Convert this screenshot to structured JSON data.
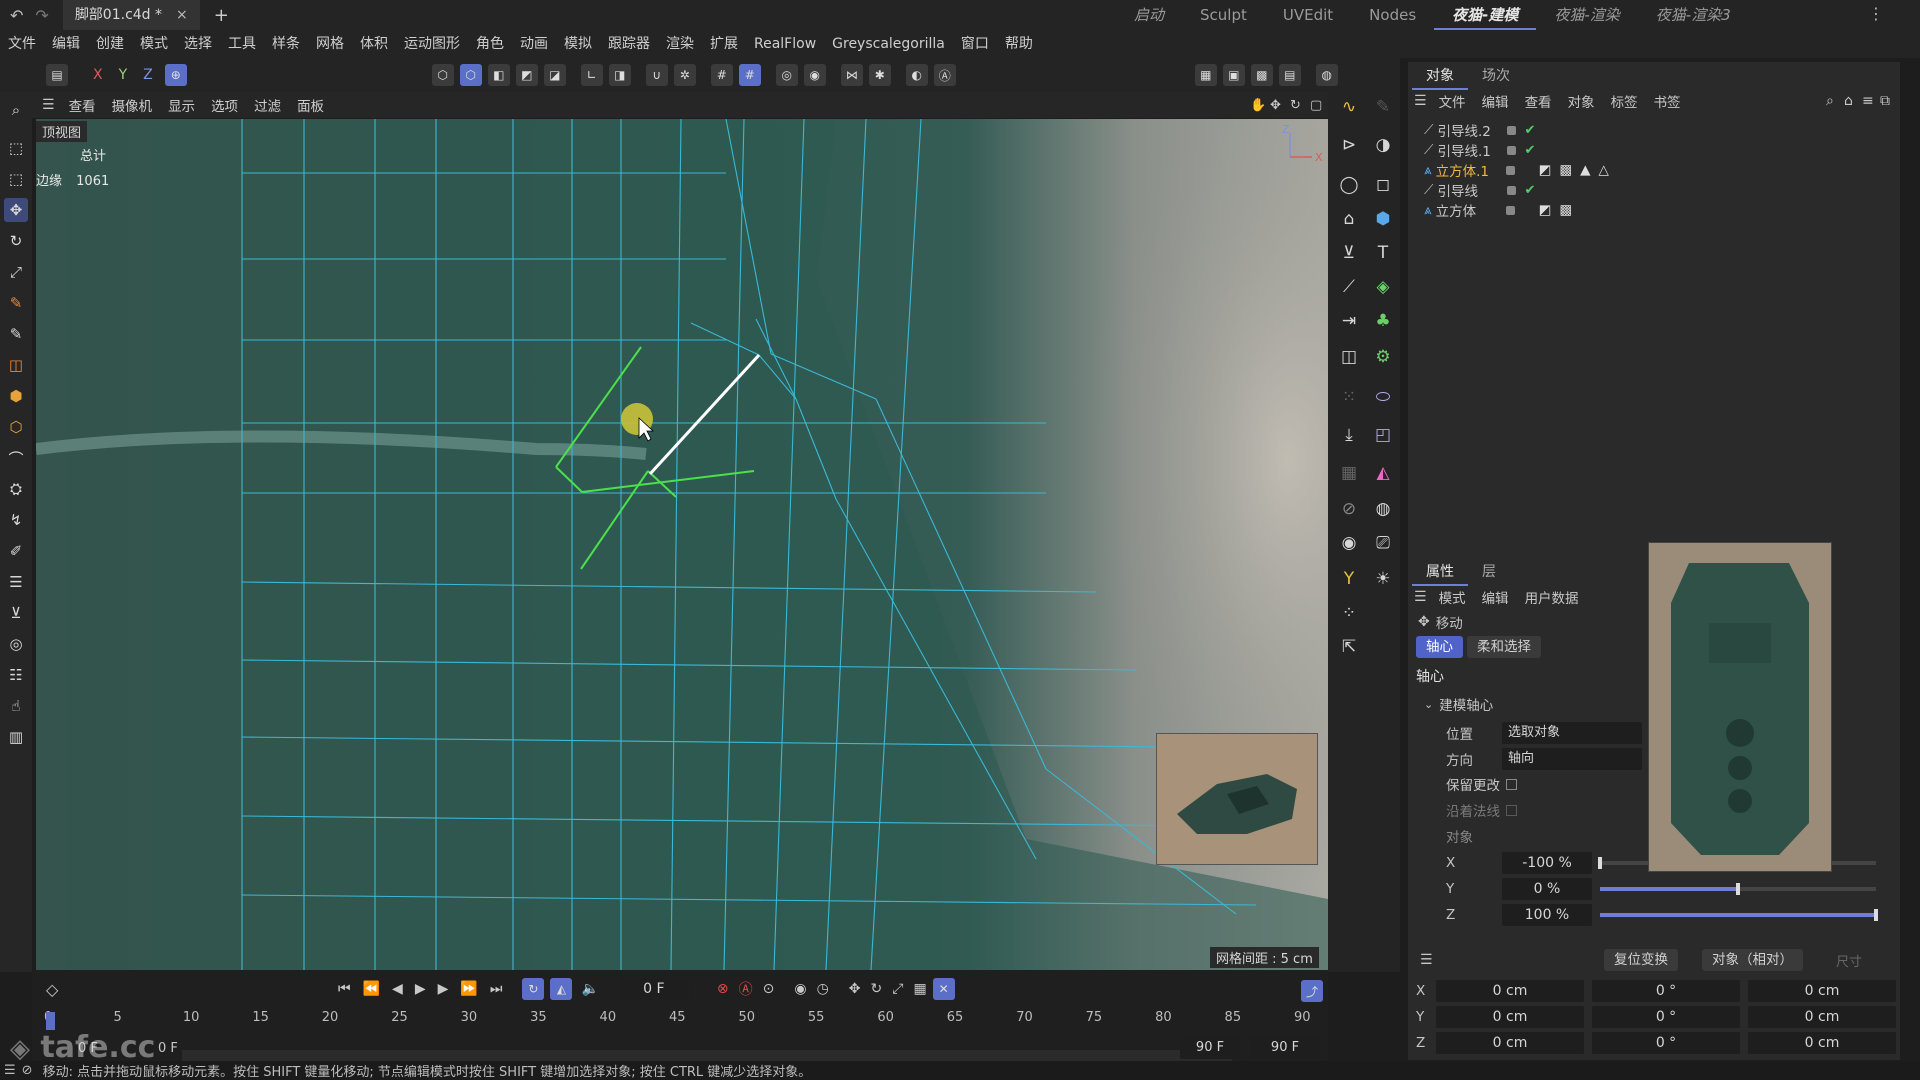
{
  "titlebar": {
    "file_tab": "脚部01.c4d *",
    "close_glyph": "×",
    "new_tab_glyph": "+",
    "layouts": [
      "启动",
      "Sculpt",
      "UVEdit",
      "Nodes",
      "夜猫-建模",
      "夜猫-渲染",
      "夜猫-渲染3"
    ],
    "active_layout": "夜猫-建模"
  },
  "menubar": [
    "文件",
    "编辑",
    "创建",
    "模式",
    "选择",
    "工具",
    "样条",
    "网格",
    "体积",
    "运动图形",
    "角色",
    "动画",
    "模拟",
    "跟踪器",
    "渲染",
    "扩展",
    "RealFlow",
    "Greyscalegorilla",
    "窗口",
    "帮助"
  ],
  "toolbar": {
    "axes": [
      "X",
      "Y",
      "Z"
    ]
  },
  "viewport_menu": [
    "查看",
    "摄像机",
    "显示",
    "选项",
    "过滤",
    "面板"
  ],
  "viewport": {
    "name": "顶视图",
    "stats_header": "总计",
    "stats_label": "边缘",
    "stats_value": "1061",
    "grid_spacing": "网格间距 : 5 cm",
    "mesh_color": "#3bb8d6",
    "selected_edge_color": "#ffffff",
    "neighbor_edge_color": "#4ce04a"
  },
  "timeline": {
    "frame_field": "0 F",
    "ticks": [
      "0",
      "5",
      "10",
      "15",
      "20",
      "25",
      "30",
      "35",
      "40",
      "45",
      "50",
      "55",
      "60",
      "65",
      "70",
      "75",
      "80",
      "85",
      "90"
    ],
    "start_field": "0 F",
    "start_field2": "0 F",
    "end_field": "90 F",
    "end_field2": "90 F"
  },
  "status": "移动: 点击并拖动鼠标移动元素。按住 SHIFT 键量化移动; 节点编辑模式时按住 SHIFT 键增加选择对象; 按住 CTRL 键减少选择对象。",
  "watermark": "tafe.cc",
  "object_panel": {
    "tabs": [
      "对象",
      "场次"
    ],
    "menu": [
      "文件",
      "编辑",
      "查看",
      "对象",
      "标签",
      "书签"
    ],
    "objects": [
      {
        "name": "引导线.2",
        "type": "spline",
        "selected": false,
        "checked": true
      },
      {
        "name": "引导线.1",
        "type": "spline",
        "selected": false,
        "checked": true
      },
      {
        "name": "立方体.1",
        "type": "poly",
        "selected": true,
        "checked": false
      },
      {
        "name": "引导线",
        "type": "spline",
        "selected": false,
        "checked": true
      },
      {
        "name": "立方体",
        "type": "poly",
        "selected": false,
        "checked": false
      }
    ]
  },
  "attr_panel": {
    "tabs": [
      "属性",
      "层"
    ],
    "menu": [
      "模式",
      "编辑",
      "用户数据"
    ],
    "tool_name": "移动",
    "subtabs": [
      "轴心",
      "柔和选择"
    ],
    "section_title": "轴心",
    "group_title": "建模轴心",
    "position_label": "位置",
    "position_value": "选取对象",
    "orientation_label": "方向",
    "orientation_value": "轴向",
    "keep_changes_label": "保留更改",
    "along_normal_label": "沿着法线",
    "object_label": "对象",
    "axes": [
      {
        "label": "X",
        "value": "-100 %",
        "fraction": 0.0
      },
      {
        "label": "Y",
        "value": "0 %",
        "fraction": 0.5
      },
      {
        "label": "Z",
        "value": "100 %",
        "fraction": 1.0
      }
    ]
  },
  "coord_panel": {
    "reset_button": "复位变换",
    "mode_select": "对象（相对）",
    "size_label": "尺寸",
    "rows": [
      {
        "axis": "X",
        "pos": "0 cm",
        "rot": "0 °",
        "size": "0 cm"
      },
      {
        "axis": "Y",
        "pos": "0 cm",
        "rot": "0 °",
        "size": "0 cm"
      },
      {
        "axis": "Z",
        "pos": "0 cm",
        "rot": "0 °",
        "size": "0 cm"
      }
    ]
  }
}
